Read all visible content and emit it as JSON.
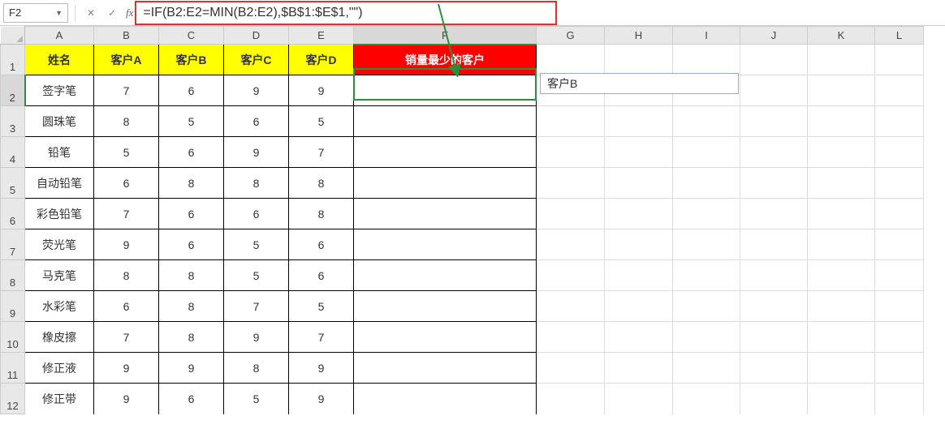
{
  "nameBox": {
    "value": "F2"
  },
  "formulaBar": {
    "cancel": "✕",
    "confirm": "✓",
    "fx": "fx",
    "formula": "=IF(B2:E2=MIN(B2:E2),$B$1:$E$1,\"\")"
  },
  "columns": [
    "A",
    "B",
    "C",
    "D",
    "E",
    "F",
    "G",
    "H",
    "I",
    "J",
    "K",
    "L"
  ],
  "rowNumbers": [
    "1",
    "2",
    "3",
    "4",
    "5",
    "6",
    "7",
    "8",
    "9",
    "10",
    "11",
    "12"
  ],
  "selectedCol": "F",
  "selectedRow": "2",
  "header": {
    "name": "姓名",
    "custA": "客户A",
    "custB": "客户B",
    "custC": "客户C",
    "custD": "客户D",
    "minCust": "销量最少的客户"
  },
  "rows": [
    {
      "name": "签字笔",
      "a": "7",
      "b": "6",
      "c": "9",
      "d": "9"
    },
    {
      "name": "圆珠笔",
      "a": "8",
      "b": "5",
      "c": "6",
      "d": "5"
    },
    {
      "name": "铅笔",
      "a": "5",
      "b": "6",
      "c": "9",
      "d": "7"
    },
    {
      "name": "自动铅笔",
      "a": "6",
      "b": "8",
      "c": "8",
      "d": "8"
    },
    {
      "name": "彩色铅笔",
      "a": "7",
      "b": "6",
      "c": "6",
      "d": "8"
    },
    {
      "name": "荧光笔",
      "a": "9",
      "b": "6",
      "c": "5",
      "d": "6"
    },
    {
      "name": "马克笔",
      "a": "8",
      "b": "8",
      "c": "5",
      "d": "6"
    },
    {
      "name": "水彩笔",
      "a": "6",
      "b": "8",
      "c": "7",
      "d": "5"
    },
    {
      "name": "橡皮擦",
      "a": "7",
      "b": "8",
      "c": "9",
      "d": "7"
    },
    {
      "name": "修正液",
      "a": "9",
      "b": "9",
      "c": "8",
      "d": "9"
    },
    {
      "name": "修正带",
      "a": "9",
      "b": "6",
      "c": "5",
      "d": "9"
    }
  ],
  "spillResult": "客户B",
  "chart_data": {
    "type": "table",
    "title": "",
    "columns": [
      "姓名",
      "客户A",
      "客户B",
      "客户C",
      "客户D",
      "销量最少的客户"
    ],
    "data": [
      [
        "签字笔",
        7,
        6,
        9,
        9,
        null
      ],
      [
        "圆珠笔",
        8,
        5,
        6,
        5,
        null
      ],
      [
        "铅笔",
        5,
        6,
        9,
        7,
        null
      ],
      [
        "自动铅笔",
        6,
        8,
        8,
        8,
        null
      ],
      [
        "彩色铅笔",
        7,
        6,
        6,
        8,
        null
      ],
      [
        "荧光笔",
        9,
        6,
        5,
        6,
        null
      ],
      [
        "马克笔",
        8,
        8,
        5,
        6,
        null
      ],
      [
        "水彩笔",
        6,
        8,
        7,
        5,
        null
      ],
      [
        "橡皮擦",
        7,
        8,
        9,
        7,
        null
      ],
      [
        "修正液",
        9,
        9,
        8,
        9,
        null
      ],
      [
        "修正带",
        9,
        6,
        5,
        9,
        null
      ]
    ]
  }
}
